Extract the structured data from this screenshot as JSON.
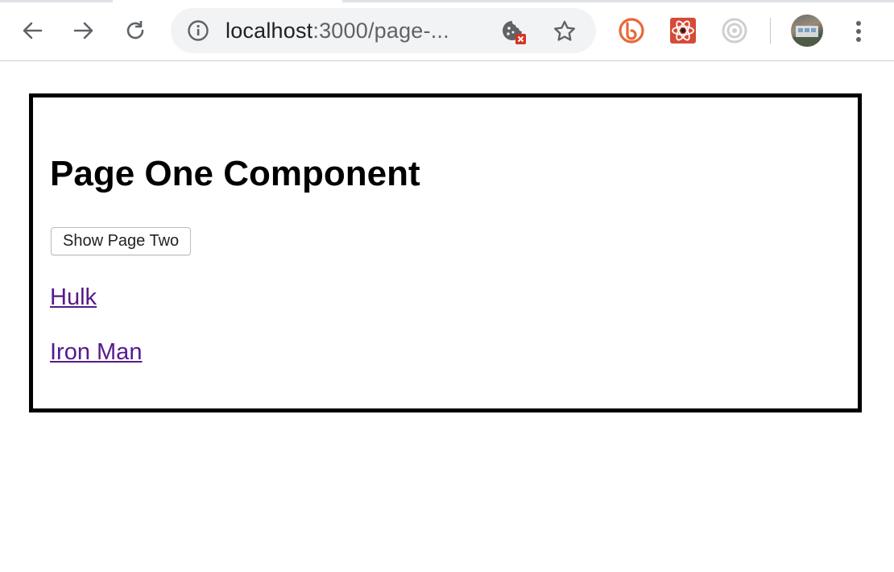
{
  "browser": {
    "url_host": "localhost",
    "url_rest": ":3000/page-...",
    "icons": {
      "back": "back-arrow-icon",
      "forward": "forward-arrow-icon",
      "reload": "reload-icon",
      "info": "info-icon",
      "cookie": "blocked-cookie-icon",
      "star": "bookmark-star-icon",
      "ext1": "bitly-extension-icon",
      "ext2": "react-devtools-extension-icon",
      "ext3": "target-extension-icon",
      "profile": "profile-avatar",
      "menu": "kebab-menu-icon"
    }
  },
  "page": {
    "heading": "Page One Component",
    "button_label": "Show Page Two",
    "links": [
      "Hulk",
      "Iron Man"
    ]
  },
  "colors": {
    "link_visited": "#551a8b",
    "frame_border": "#000000",
    "ext_orange": "#e8683a",
    "ext_red": "#d64b36"
  }
}
